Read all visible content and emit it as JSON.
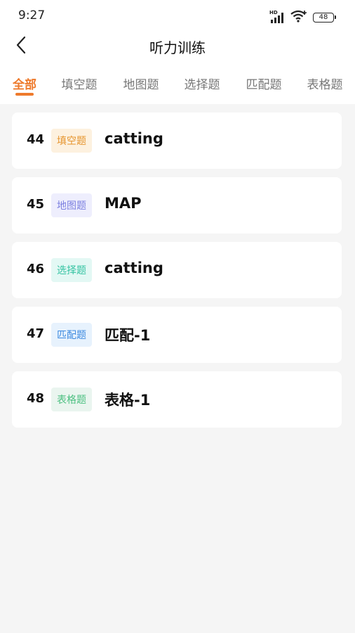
{
  "status_bar": {
    "time": "9:27",
    "hd_label": "HD",
    "battery": "48"
  },
  "header": {
    "title": "听力训练",
    "back_icon": "chevron-left-icon"
  },
  "tabs": [
    {
      "label": "全部",
      "active": true
    },
    {
      "label": "填空题",
      "active": false
    },
    {
      "label": "地图题",
      "active": false
    },
    {
      "label": "选择题",
      "active": false
    },
    {
      "label": "匹配题",
      "active": false
    },
    {
      "label": "表格题",
      "active": false
    }
  ],
  "colors": {
    "accent": "#ee7a2c",
    "background": "#f5f5f5",
    "card": "#ffffff"
  },
  "items": [
    {
      "number": "44",
      "type": "填空题",
      "title": "catting",
      "badge_bg": "#fdf1df",
      "badge_fg": "#e6952e"
    },
    {
      "number": "45",
      "type": "地图题",
      "title": "MAP",
      "badge_bg": "#eeeefd",
      "badge_fg": "#7b7fe0"
    },
    {
      "number": "46",
      "type": "选择题",
      "title": "catting",
      "badge_bg": "#e3f8f4",
      "badge_fg": "#34c3a2"
    },
    {
      "number": "47",
      "type": "匹配题",
      "title": "匹配-1",
      "badge_bg": "#e7f2fd",
      "badge_fg": "#3d8ae0"
    },
    {
      "number": "48",
      "type": "表格题",
      "title": "表格-1",
      "badge_bg": "#eaf5ef",
      "badge_fg": "#4cc081"
    }
  ]
}
